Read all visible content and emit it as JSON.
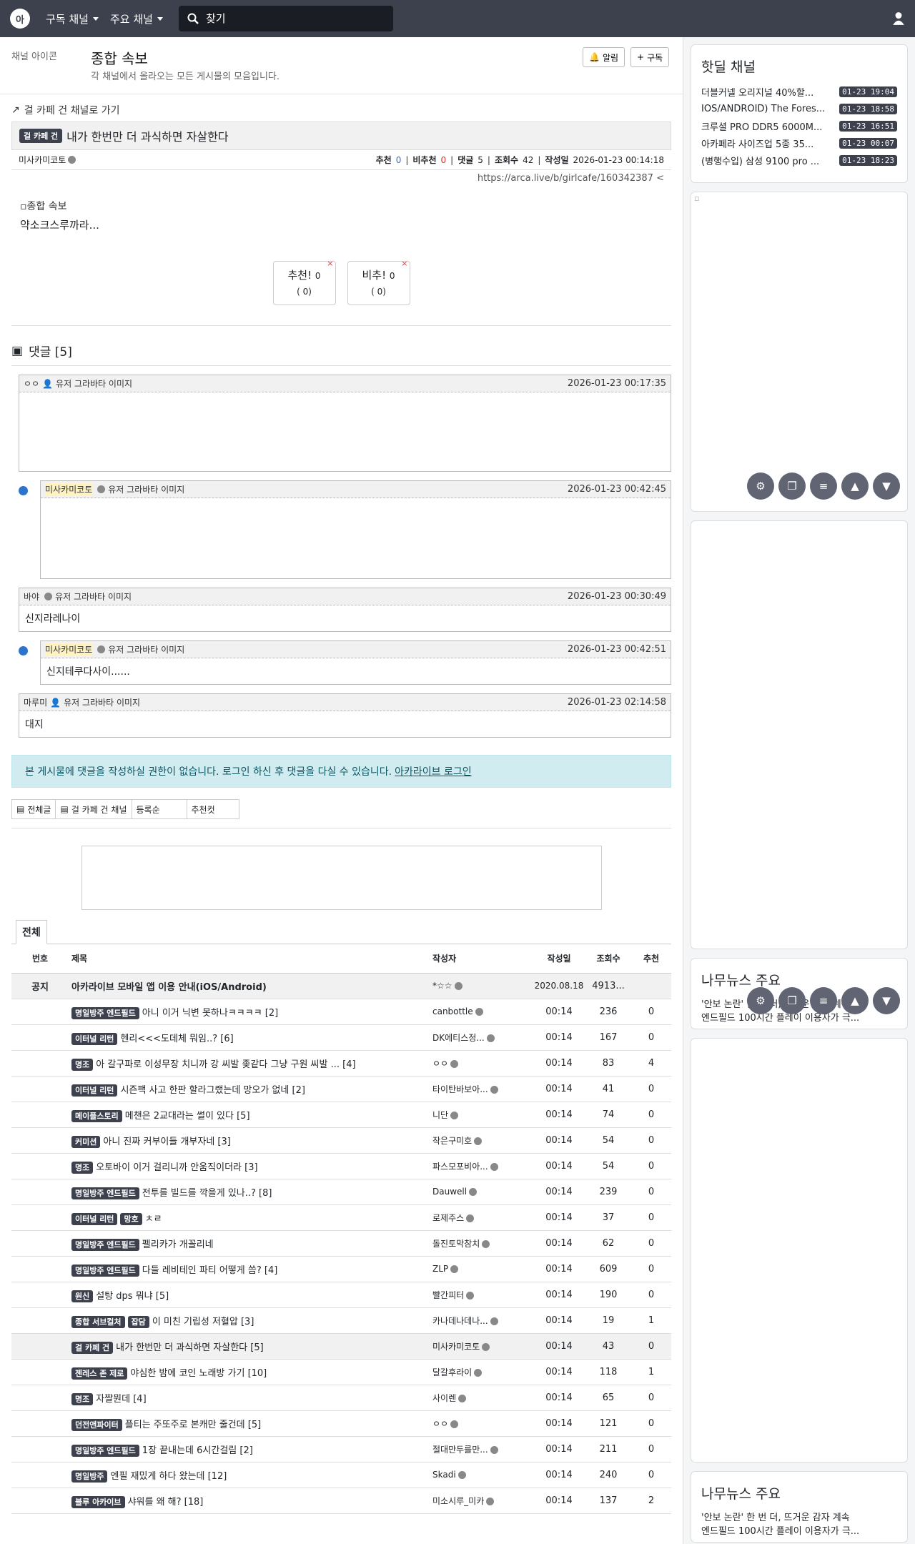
{
  "nav": {
    "logo_text": "아",
    "subscribed": "구독 채널",
    "main_channels": "주요 채널",
    "search_placeholder": "찾기"
  },
  "channel": {
    "icon_alt": "채널 아이콘",
    "title": "종합 속보",
    "description": "각 채널에서 올라오는 모든 게시물의 모음입니다.",
    "alarm": "알림",
    "subscribe": "구독"
  },
  "article": {
    "goto": "걸 카페 건 채널로 가기",
    "category": "걸 카페 건",
    "title": "내가 한번만 더 과식하면 자살한다",
    "author": "미사카미코토",
    "rec_label": "추천",
    "rec": "0",
    "unrec_label": "비추천",
    "unrec": "0",
    "comments_label": "댓글",
    "comments": "5",
    "views_label": "조회수",
    "views": "42",
    "date_label": "작성일",
    "date": "2026-01-23 00:14:18",
    "url": "https://arca.live/b/girlcafe/160342387",
    "image_alt": "종합 속보",
    "body": "약소크스루까라...",
    "vote_up": "추천!",
    "vote_up_count": "0",
    "vote_up_sub": "( 0)",
    "vote_down": "비추!",
    "vote_down_count": "0",
    "vote_down_sub": "( 0)"
  },
  "comments": {
    "header": "댓글 [5]",
    "avatar_alt": "유저 그라바타 이미지",
    "items": [
      {
        "author": "ㅇㅇ",
        "date": "2026-01-23 00:17:35",
        "text": ""
      },
      {
        "author": "미사카미코토",
        "date": "2026-01-23 00:42:45",
        "text": ""
      },
      {
        "author": "바야",
        "date": "2026-01-23 00:30:49",
        "text": "신지라레나이"
      },
      {
        "author": "미사카미코토",
        "date": "2026-01-23 00:42:51",
        "text": "신지테쿠다사이......"
      },
      {
        "author": "마루미",
        "date": "2026-01-23 02:14:58",
        "text": "대지"
      }
    ]
  },
  "notice": {
    "text": "본 게시물에 댓글을 작성하실 권한이 없습니다. 로그인 하신 후 댓글을 다실 수 있습니다.",
    "link": "아카라이브 로그인"
  },
  "list_tabs": {
    "all": "전체글",
    "channel": "걸 카페 건 채널",
    "order": "등록순",
    "recommend": "추천컷"
  },
  "list": {
    "tab": "전체",
    "headers": {
      "num": "번호",
      "title": "제목",
      "author": "작성자",
      "date": "작성일",
      "views": "조회수",
      "rec": "추천"
    },
    "notice_row": {
      "num": "공지",
      "title": "아카라이브 모바일 앱 이용 안내(iOS/Android)",
      "author": "*☆☆",
      "date": "2020.08.18",
      "views": "4913...",
      "rec": ""
    },
    "rows": [
      {
        "cat": "명일방주 엔드필드",
        "title": "아니 이거 닉변 못하나ㅋㅋㅋㅋ [2]",
        "author": "canbottle",
        "date": "00:14",
        "views": "236",
        "rec": "0"
      },
      {
        "cat": "이터널 리턴",
        "title": "헨리<<<도데체 뭐임..? [6]",
        "author": "DK에티스정...",
        "date": "00:14",
        "views": "167",
        "rec": "0"
      },
      {
        "cat": "명조",
        "title": "아 갈구파로 이성무장 치니까 강 씨발 좆같다 그냥 구원 씨발 ... [4]",
        "author": "ㅇㅇ",
        "date": "00:14",
        "views": "83",
        "rec": "4"
      },
      {
        "cat": "이터널 리턴",
        "title": "시즌팩 사고 한판 할라그랬는데 망오가 없네 [2]",
        "author": "타이탄바보아...",
        "date": "00:14",
        "views": "41",
        "rec": "0"
      },
      {
        "cat": "메이플스토리",
        "title": "메챈은 2교대라는 썰이 있다 [5]",
        "author": "니단",
        "date": "00:14",
        "views": "74",
        "rec": "0"
      },
      {
        "cat": "커미션",
        "title": "아니 진짜 커부이들 개부자네 [3]",
        "author": "작은구미호",
        "date": "00:14",
        "views": "54",
        "rec": "0"
      },
      {
        "cat": "명조",
        "title": "오토바이 이거 걸리니까 안움직이더라 [3]",
        "author": "파스모포비아...",
        "date": "00:14",
        "views": "54",
        "rec": "0"
      },
      {
        "cat": "명일방주 엔드필드",
        "title": "전투를 빌드를 깍을게 있나..? [8]",
        "author": "Dauwell",
        "date": "00:14",
        "views": "239",
        "rec": "0"
      },
      {
        "cat": "이터널 리턴",
        "cat2": "망호",
        "title": "ㅊㄹ",
        "author": "로제주스",
        "date": "00:14",
        "views": "37",
        "rec": "0"
      },
      {
        "cat": "명일방주 엔드필드",
        "title": "펠리카가 개꼴리네",
        "author": "돌진토막참치",
        "date": "00:14",
        "views": "62",
        "rec": "0"
      },
      {
        "cat": "명일방주 엔드필드",
        "title": "다들 레비테인 파티 어떻게 씀? [4]",
        "author": "ZLP",
        "date": "00:14",
        "views": "609",
        "rec": "0"
      },
      {
        "cat": "원신",
        "title": "설탕 dps 뭐냐 [5]",
        "author": "빨간피터",
        "date": "00:14",
        "views": "190",
        "rec": "0"
      },
      {
        "cat": "종합 서브컬처",
        "cat2": "잡담",
        "title": "이 미친 기립성 저혈압 [3]",
        "author": "카나데나데나...",
        "date": "00:14",
        "views": "19",
        "rec": "1"
      },
      {
        "cat": "걸 카페 건",
        "title": "내가 한번만 더 과식하면 자살한다 [5]",
        "author": "미사카미코토",
        "date": "00:14",
        "views": "43",
        "rec": "0"
      },
      {
        "cat": "젠레스 존 제로",
        "title": "야심한 밤에 코인 노래방 가기 [10]",
        "author": "달갈후라이",
        "date": "00:14",
        "views": "118",
        "rec": "1"
      },
      {
        "cat": "명조",
        "title": "자짤뭔데 [4]",
        "author": "사이렌",
        "date": "00:14",
        "views": "65",
        "rec": "0"
      },
      {
        "cat": "던전앤파이터",
        "title": "플티는 주또주로 본캐만 줄건데 [5]",
        "author": "ㅇㅇ",
        "date": "00:14",
        "views": "121",
        "rec": "0"
      },
      {
        "cat": "명일방주 엔드필드",
        "title": "1장 끝내는데 6시간걸림 [2]",
        "author": "절대만두를만...",
        "date": "00:14",
        "views": "211",
        "rec": "0"
      },
      {
        "cat": "명일방주",
        "title": "엔필 재밌게 하다 왔는데 [12]",
        "author": "Skadi",
        "date": "00:14",
        "views": "240",
        "rec": "0"
      },
      {
        "cat": "블루 아카이브",
        "title": "샤워를 왜 해? [18]",
        "author": "미소시루_미카",
        "date": "00:14",
        "views": "137",
        "rec": "2"
      }
    ]
  },
  "sidebar": {
    "hot_title": "핫딜 채널",
    "hot": [
      {
        "title": "더블커넬 오리지널 40%할...",
        "date": "01-23 19:04"
      },
      {
        "title": "IOS/ANDROID) The Fores...",
        "date": "01-23 18:58"
      },
      {
        "title": "크루셜 PRO DDR5 6000M...",
        "date": "01-23 16:51"
      },
      {
        "title": "아카페라 사이즈업 5종 35...",
        "date": "01-23 00:07"
      },
      {
        "title": "(병행수입) 삼성 9100 pro ...",
        "date": "01-23 18:23"
      }
    ],
    "news_title": "나무뉴스 주요",
    "news": [
      "'안보 논란' 한 번 더, 뜨거운 감자 계속",
      "엔드필드 100시간 플레이 이용자가 극..."
    ]
  }
}
